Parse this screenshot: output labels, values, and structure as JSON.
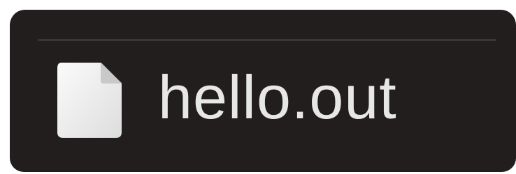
{
  "file": {
    "name": "hello.out",
    "icon": "document-icon"
  }
}
